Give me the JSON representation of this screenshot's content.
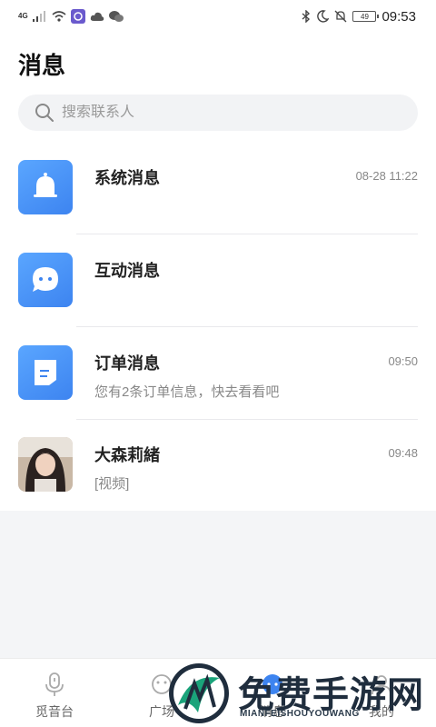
{
  "status_bar": {
    "network_label": "4G",
    "battery_level": "49",
    "time": "09:53"
  },
  "page": {
    "title": "消息"
  },
  "search": {
    "placeholder": "搜索联系人"
  },
  "messages": [
    {
      "name": "系统消息",
      "time": "08-28 11:22",
      "preview": "",
      "icon": "bell-icon"
    },
    {
      "name": "互动消息",
      "time": "",
      "preview": "",
      "icon": "chat-bubble-icon"
    },
    {
      "name": "订单消息",
      "time": "09:50",
      "preview": "您有2条订单信息，快去看看吧",
      "icon": "order-doc-icon"
    },
    {
      "name": "大森莉緒",
      "time": "09:48",
      "preview": "[视频]",
      "icon": "user-photo"
    }
  ],
  "bottom_nav": {
    "items": [
      {
        "label": "觅音台",
        "icon": "microphone-icon"
      },
      {
        "label": "广场",
        "icon": "square-icon"
      },
      {
        "label": "消息",
        "icon": "message-icon"
      },
      {
        "label": "我的",
        "icon": "profile-icon"
      }
    ]
  },
  "watermark": {
    "title": "免费手游网",
    "subtitle": "MIANFEISHOUYOUWANG"
  },
  "colors": {
    "accent_blue": "#3d84f0",
    "background": "#f4f5f7"
  }
}
